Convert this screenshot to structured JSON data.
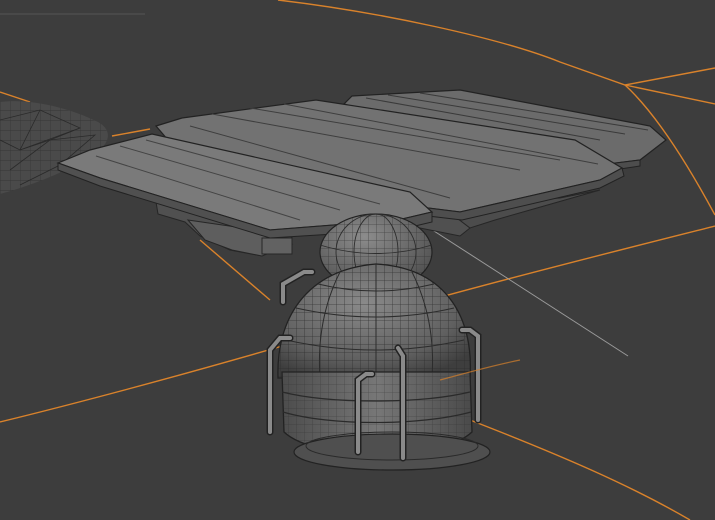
{
  "viewport": {
    "kind": "3d-viewport-wireframe-overlay",
    "colors": {
      "background": "#3d3d3d",
      "model_fill": "#595959",
      "model_light": "#7a7a7a",
      "model_dark": "#262626",
      "wire": "#2b2b2b",
      "selection_edge": "#d9822b",
      "guide_line": "#9a9a9a"
    },
    "objects": [
      "solar-panel-left",
      "solar-panel-middle",
      "solar-panel-right",
      "panel-support-frame",
      "sphere-joint",
      "dome-body",
      "base-ring",
      "vertical-pipes",
      "rock-mesh"
    ]
  }
}
